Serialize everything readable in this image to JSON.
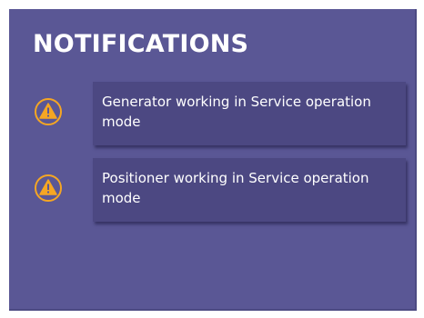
{
  "panel": {
    "title": "NOTIFICATIONS"
  },
  "notifications": [
    {
      "icon": "warning-icon",
      "message": "Generator working in Service operation mode"
    },
    {
      "icon": "warning-icon",
      "message": "Positioner working in Service operation mode"
    }
  ],
  "colors": {
    "panel_background": "#5a5795",
    "card_background": "#4c4882",
    "warning_orange": "#f5a623",
    "text": "#ffffff"
  }
}
